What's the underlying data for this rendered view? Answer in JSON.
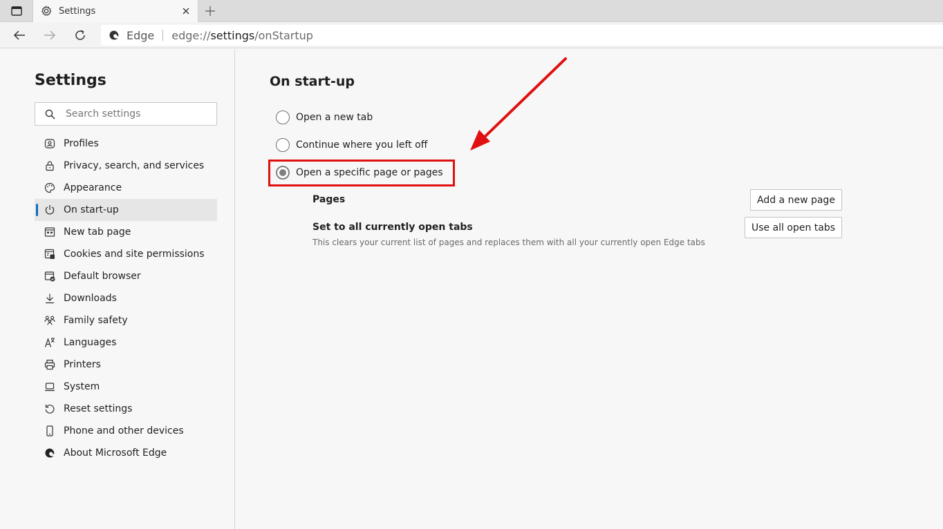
{
  "tab": {
    "title": "Settings"
  },
  "address_bar": {
    "site_name": "Edge",
    "url_scheme": "edge://",
    "url_host": "settings",
    "url_path": "/onStartup"
  },
  "sidebar": {
    "title": "Settings",
    "search_placeholder": "Search settings",
    "items": [
      {
        "label": "Profiles",
        "icon": "profiles-icon"
      },
      {
        "label": "Privacy, search, and services",
        "icon": "lock-icon"
      },
      {
        "label": "Appearance",
        "icon": "palette-icon"
      },
      {
        "label": "On start-up",
        "icon": "power-icon",
        "active": true
      },
      {
        "label": "New tab page",
        "icon": "new-tab-page-icon"
      },
      {
        "label": "Cookies and site permissions",
        "icon": "cookies-icon"
      },
      {
        "label": "Default browser",
        "icon": "default-browser-icon"
      },
      {
        "label": "Downloads",
        "icon": "download-icon"
      },
      {
        "label": "Family safety",
        "icon": "family-icon"
      },
      {
        "label": "Languages",
        "icon": "languages-icon"
      },
      {
        "label": "Printers",
        "icon": "printer-icon"
      },
      {
        "label": "System",
        "icon": "laptop-icon"
      },
      {
        "label": "Reset settings",
        "icon": "reset-icon"
      },
      {
        "label": "Phone and other devices",
        "icon": "phone-icon"
      },
      {
        "label": "About Microsoft Edge",
        "icon": "edge-logo-icon"
      }
    ]
  },
  "main": {
    "title": "On start-up",
    "options": [
      {
        "label": "Open a new tab",
        "checked": false
      },
      {
        "label": "Continue where you left off",
        "checked": false
      },
      {
        "label": "Open a specific page or pages",
        "checked": true
      }
    ],
    "pages_label": "Pages",
    "add_page_button": "Add a new page",
    "set_tabs_title": "Set to all currently open tabs",
    "set_tabs_desc": "This clears your current list of pages and replaces them with all your currently open Edge tabs",
    "use_tabs_button": "Use all open tabs"
  },
  "colors": {
    "accent": "#0f6cbd",
    "annotation": "#e01010"
  }
}
